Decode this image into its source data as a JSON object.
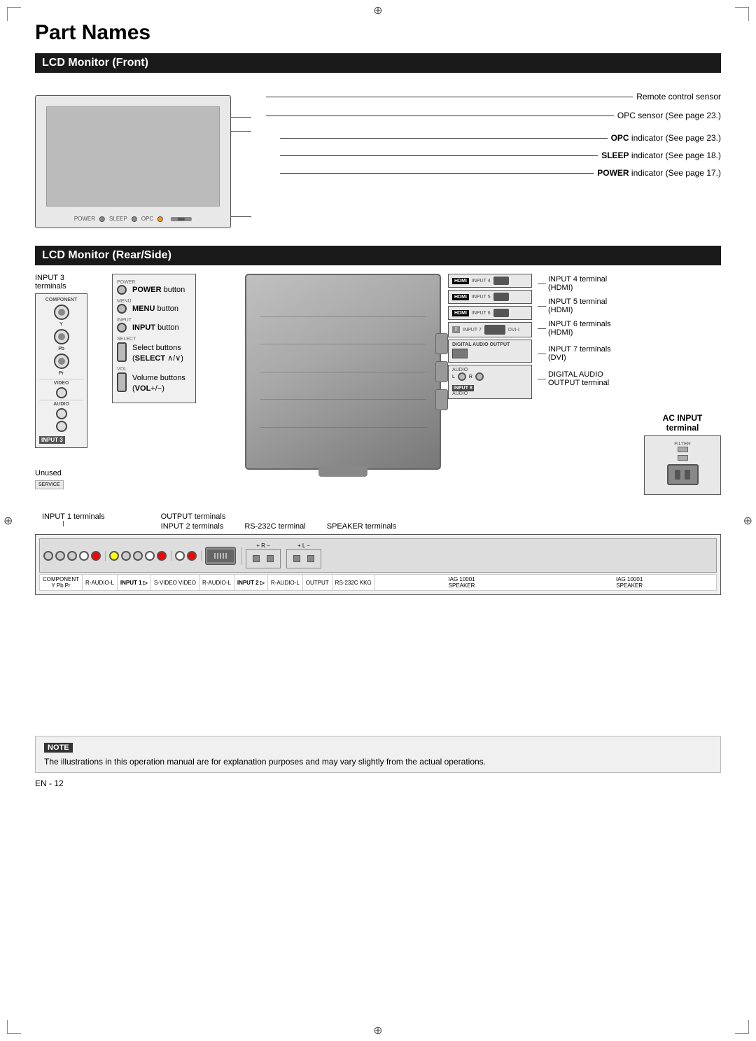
{
  "page": {
    "title": "Part Names",
    "page_number": "EN - 12"
  },
  "front_section": {
    "header": "LCD Monitor (Front)",
    "labels": [
      {
        "text": "Remote control sensor",
        "bold": false
      },
      {
        "text": "OPC sensor (See page 23.)",
        "bold": false
      },
      {
        "text": "OPC",
        "bold": true,
        "suffix": " indicator (See page 23.)"
      },
      {
        "text": "SLEEP",
        "bold": true,
        "suffix": " indicator (See page 18.)"
      },
      {
        "text": "POWER",
        "bold": true,
        "suffix": " indicator (See page 17.)"
      }
    ],
    "button_labels": [
      "POWER",
      "SLEEP",
      "OPC"
    ]
  },
  "rear_section": {
    "header": "LCD Monitor (Rear/Side)",
    "left_panel": {
      "label": "INPUT 3",
      "sublabel": "terminals",
      "unused": "Unused",
      "tag": "INPUT 3",
      "connector_labels": [
        "COMPONENT",
        "Y",
        "Pb",
        "Pr",
        "VIDEO",
        "AUDIO"
      ]
    },
    "center_panel": {
      "buttons": [
        {
          "section": "POWER",
          "label": "POWER button",
          "bold_part": "POWER"
        },
        {
          "section": "MENU",
          "label": "MENU button",
          "bold_part": "MENU"
        },
        {
          "section": "INPUT",
          "label": "INPUT button",
          "bold_part": "INPUT"
        },
        {
          "section": "SELECT",
          "label": "Select buttons",
          "sublabel": "(SELECT ∧/∨)"
        },
        {
          "section": "VOL",
          "label": "Volume buttons",
          "sublabel": "(VOL+/−)"
        }
      ]
    },
    "right_panel": {
      "inputs": [
        {
          "tag": "HDMI",
          "input_num": "INPUT 4",
          "label": "INPUT 4 terminal",
          "sublabel": "(HDMI)"
        },
        {
          "tag": "HDMI",
          "input_num": "INPUT 5",
          "label": "INPUT 5 terminal",
          "sublabel": "(HDMI)"
        },
        {
          "tag": "HDMI",
          "input_num": "INPUT 6",
          "label": "INPUT 6 terminals",
          "sublabel": "(HDMI)"
        },
        {
          "tag": "DVI",
          "input_num": "INPUT 7",
          "label": "INPUT 7 terminals",
          "sublabel": "(DVI)"
        },
        {
          "tag": "DIGITAL",
          "input_num": "",
          "label": "DIGITAL AUDIO",
          "sublabel": "OUTPUT terminal"
        },
        {
          "tag": "AUDIO",
          "input_num": "INPUT 8",
          "label": "",
          "sublabel": ""
        }
      ]
    },
    "ac_input": {
      "label": "AC INPUT",
      "sublabel": "terminal"
    }
  },
  "bottom_section": {
    "labels": [
      {
        "text": "INPUT 1 terminals",
        "position": 0
      },
      {
        "text": "INPUT 2 terminals",
        "position": 1
      },
      {
        "text": "OUTPUT terminals",
        "position": 2
      },
      {
        "text": "RS-232C terminal",
        "position": 3
      },
      {
        "text": "SPEAKER terminals",
        "position": 4
      }
    ]
  },
  "note": {
    "header": "NOTE",
    "text": "The illustrations in this operation manual are for explanation purposes and may vary slightly from the actual operations."
  }
}
